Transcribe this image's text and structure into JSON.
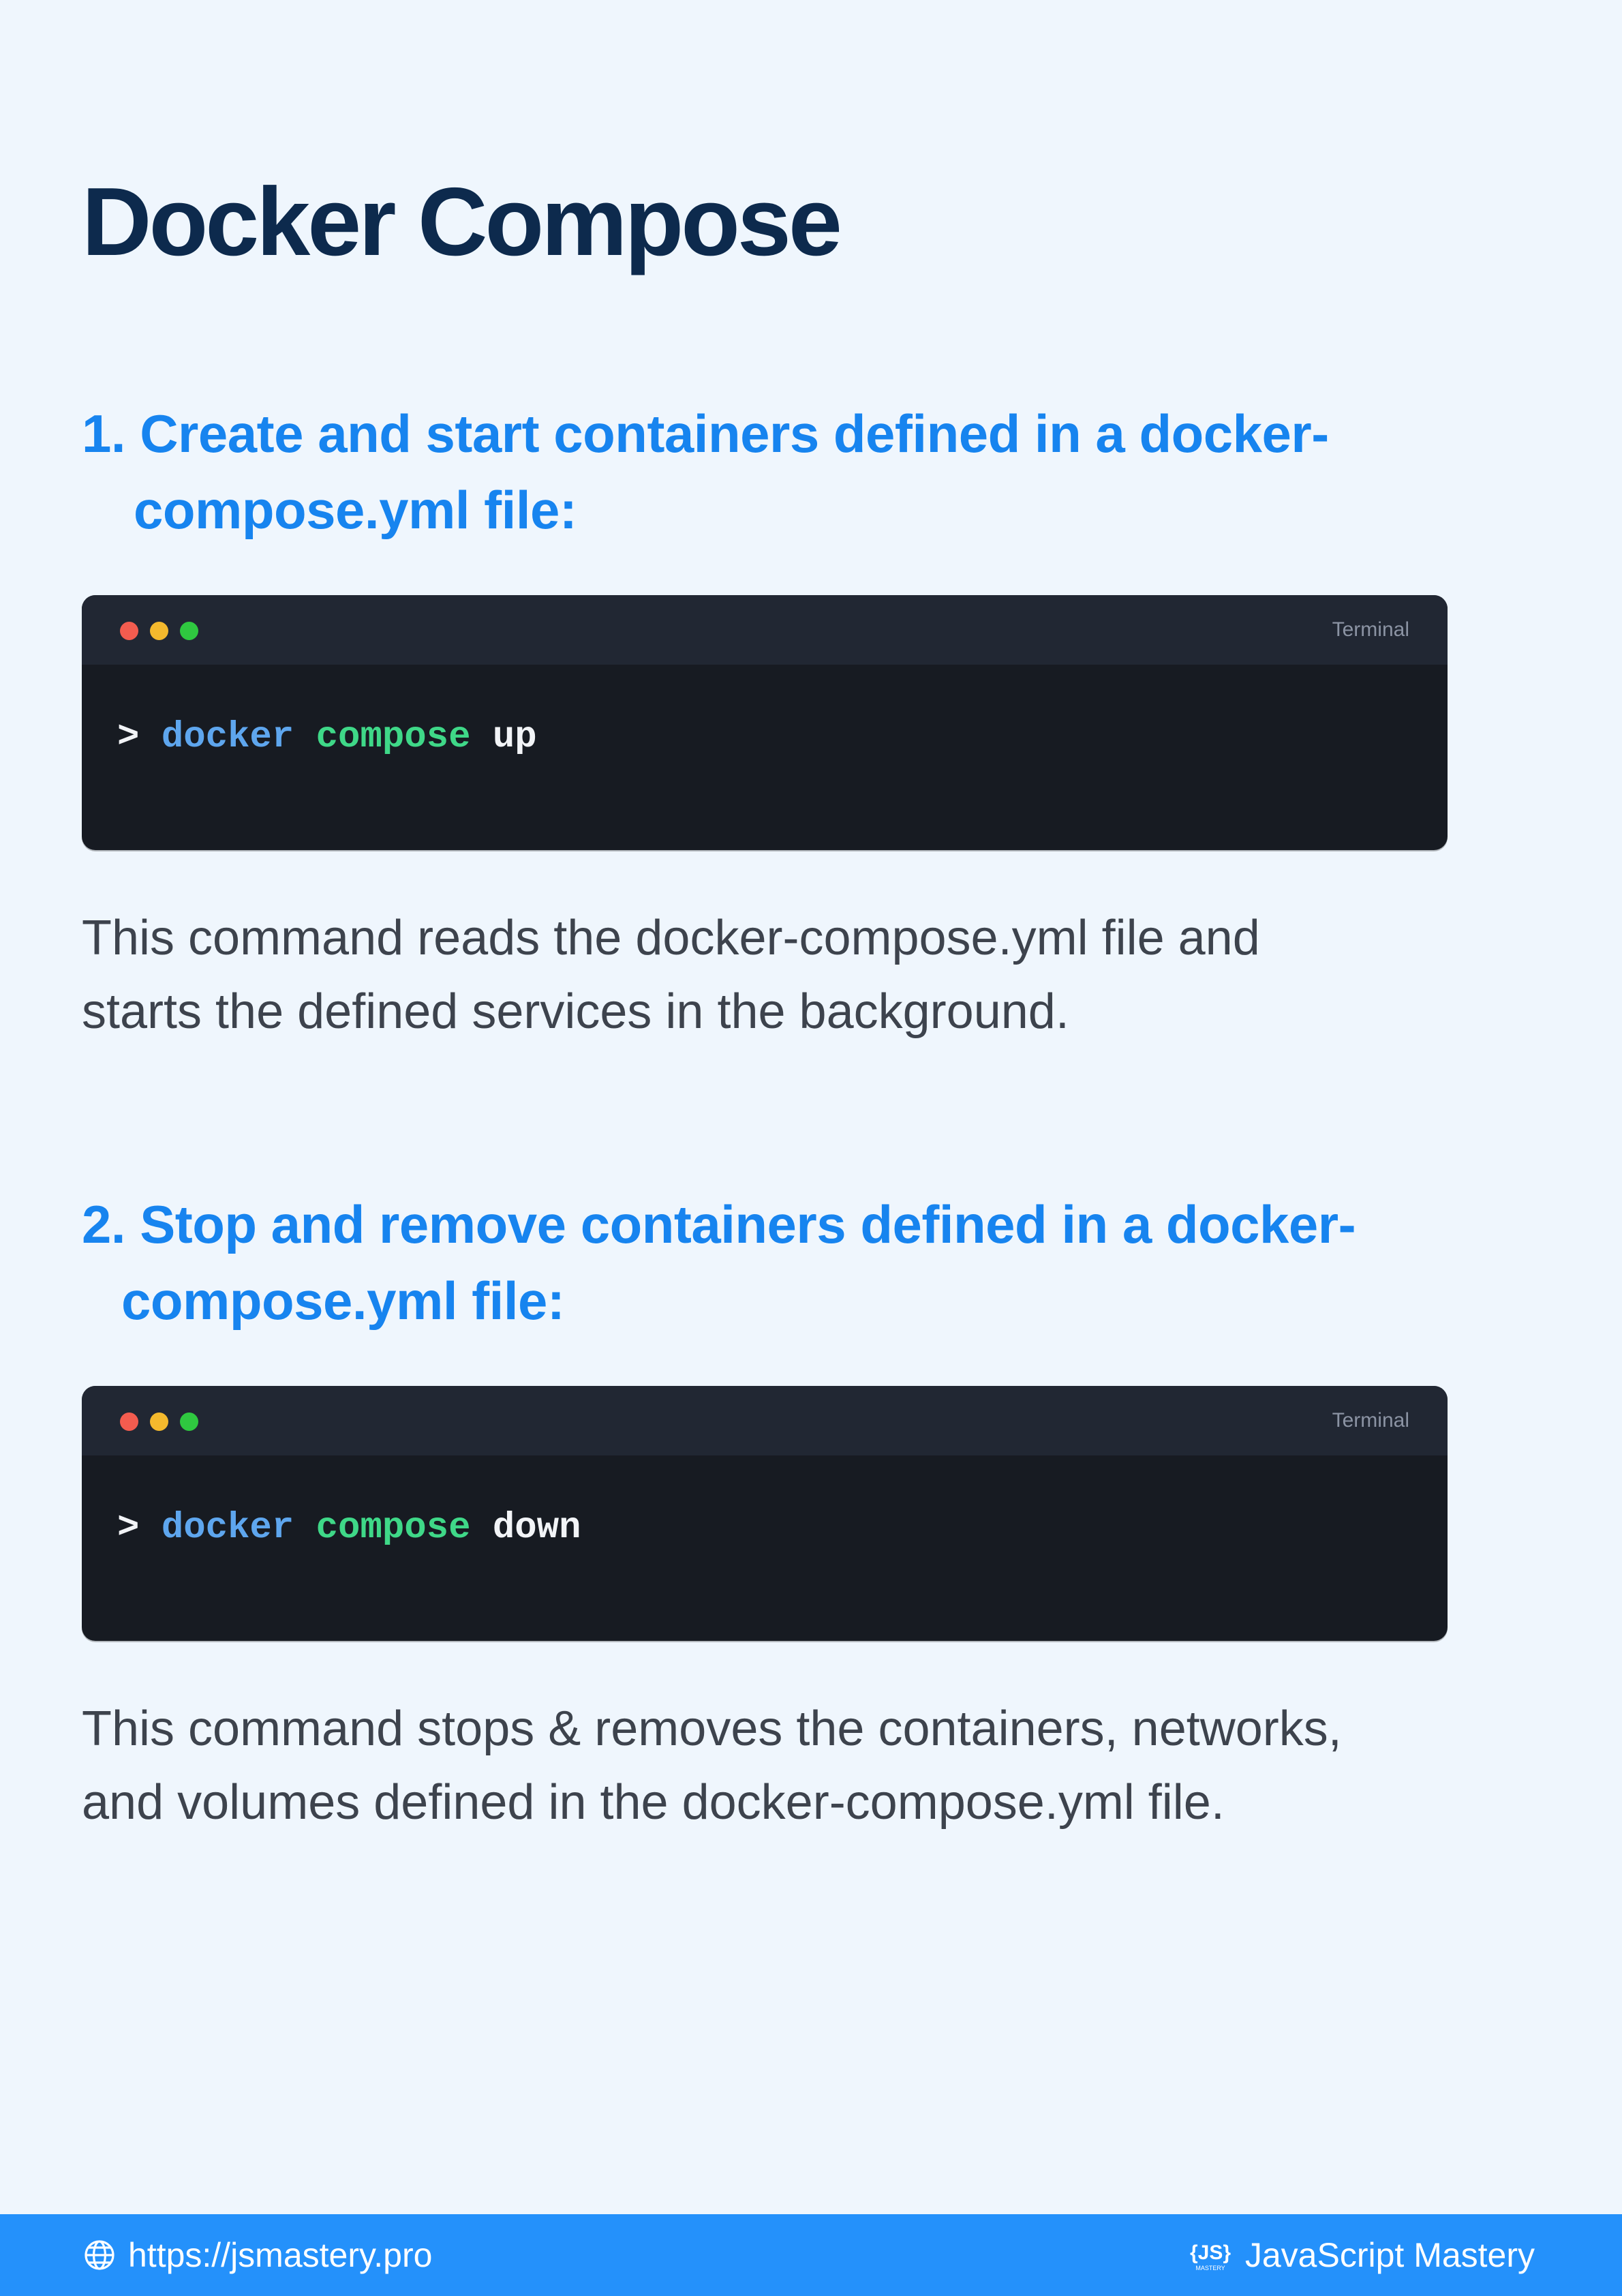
{
  "page": {
    "title": "Docker Compose"
  },
  "sections": [
    {
      "heading_line1": "1. Create and start containers defined in a docker-",
      "heading_line2": "compose.yml file:",
      "terminal": {
        "label": "Terminal",
        "prompt": ">",
        "command": "docker",
        "subcommand": "compose",
        "argument": "up"
      },
      "description_line1": "This command reads the docker-compose.yml file and",
      "description_line2": "starts the defined services in the background."
    },
    {
      "heading_line1": "2. Stop and remove containers defined in a docker-",
      "heading_line2": "compose.yml file:",
      "terminal": {
        "label": "Terminal",
        "prompt": ">",
        "command": "docker",
        "subcommand": "compose",
        "argument": "down"
      },
      "description_line1": "This command stops & removes the containers, networks,",
      "description_line2": "and volumes defined in the docker-compose.yml file."
    }
  ],
  "footer": {
    "url": "https://jsmastery.pro",
    "brand": "JavaScript Mastery",
    "logo_text": "JS",
    "logo_subtext": "MASTERY",
    "icon_left": "globe-icon",
    "icon_right": "js-logo-icon"
  },
  "colors": {
    "background": "#eff6fd",
    "title": "#0d2a4d",
    "heading": "#1784ef",
    "terminal_bg": "#171b22",
    "terminal_bar": "#212733",
    "cmd_main": "#5ea6ee",
    "cmd_sub": "#3fd888",
    "footer": "#2491fb"
  }
}
